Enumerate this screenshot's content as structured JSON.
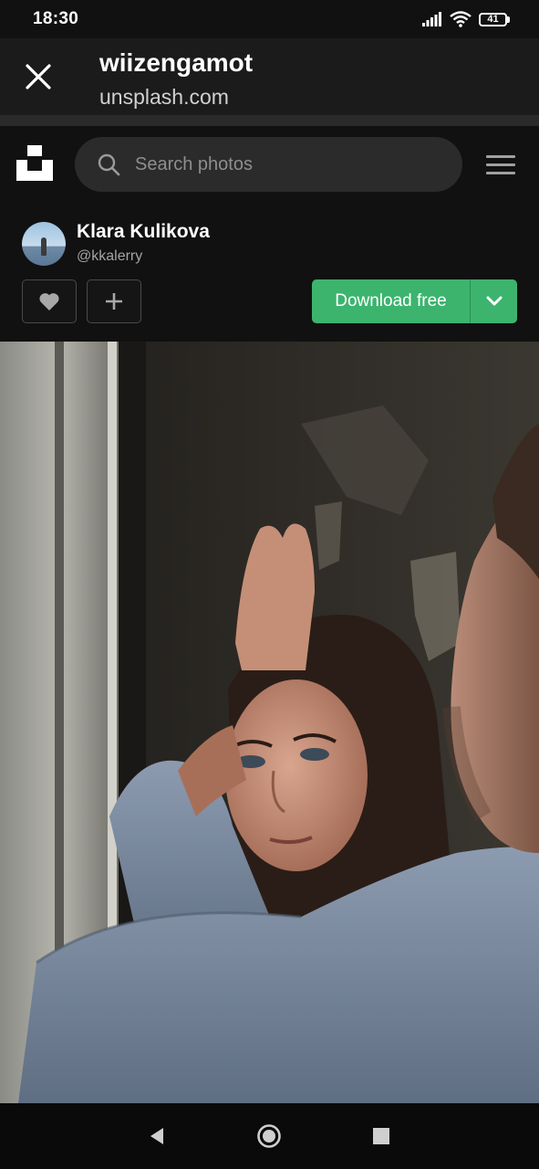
{
  "status_bar": {
    "time": "18:30",
    "battery": "41",
    "icons": [
      "signal-icon",
      "wifi-icon",
      "battery-icon"
    ]
  },
  "tab_bar": {
    "title": "wiizengamot",
    "url": "unsplash.com",
    "close_icon": "close-icon"
  },
  "header": {
    "logo_icon": "unsplash-logo-icon",
    "search_placeholder": "Search photos",
    "menu_icon": "hamburger-menu-icon"
  },
  "author": {
    "name": "Klara Kulikova",
    "handle": "@kkalerry"
  },
  "actions": {
    "like_icon": "heart-icon",
    "add_icon": "plus-icon",
    "download_label": "Download free",
    "download_caret_icon": "chevron-down-icon"
  },
  "colors": {
    "accent": "#3cb46e",
    "background": "#111111"
  },
  "nav_bar": {
    "icons": [
      "back-icon",
      "home-icon",
      "recents-icon"
    ]
  }
}
